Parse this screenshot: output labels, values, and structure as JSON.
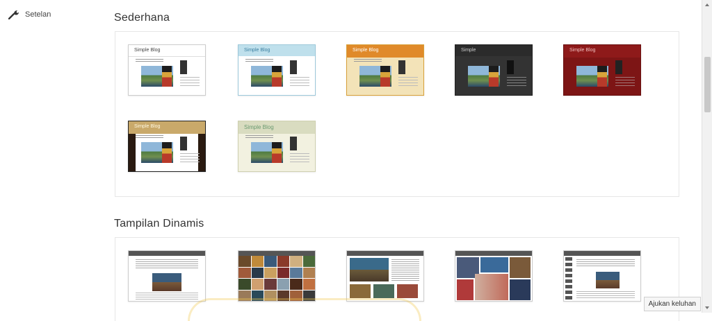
{
  "sidebar": {
    "items": [
      {
        "label": "Setelan",
        "icon": "wrench-icon"
      }
    ]
  },
  "sections": [
    {
      "title": "Sederhana",
      "templates": [
        {
          "blog_title": "Simple Blog",
          "variant": "white"
        },
        {
          "blog_title": "Simple Blog",
          "variant": "light-blue"
        },
        {
          "blog_title": "Simple Blog",
          "variant": "orange"
        },
        {
          "blog_title": "Simple",
          "variant": "dark"
        },
        {
          "blog_title": "Simple Blog",
          "variant": "red"
        },
        {
          "blog_title": "Simple Blog",
          "variant": "tan"
        },
        {
          "blog_title": "Simple Blog",
          "variant": "green-beige"
        }
      ]
    },
    {
      "title": "Tampilan Dinamis",
      "templates": [
        {
          "variant": "classic"
        },
        {
          "variant": "flipcard"
        },
        {
          "variant": "magazine"
        },
        {
          "variant": "mosaic"
        },
        {
          "variant": "sidebar"
        }
      ]
    }
  ],
  "feedback_button": {
    "label": "Ajukan keluhan"
  },
  "colors": {
    "white_header": "#ffffff",
    "light_blue_header": "#bfe0ec",
    "orange_header": "#e08a2a",
    "dark_header": "#2b2b2b",
    "red_header": "#8e1a1a",
    "tan_header": "#c9a96a",
    "green_beige_header": "#d9dcc0"
  }
}
